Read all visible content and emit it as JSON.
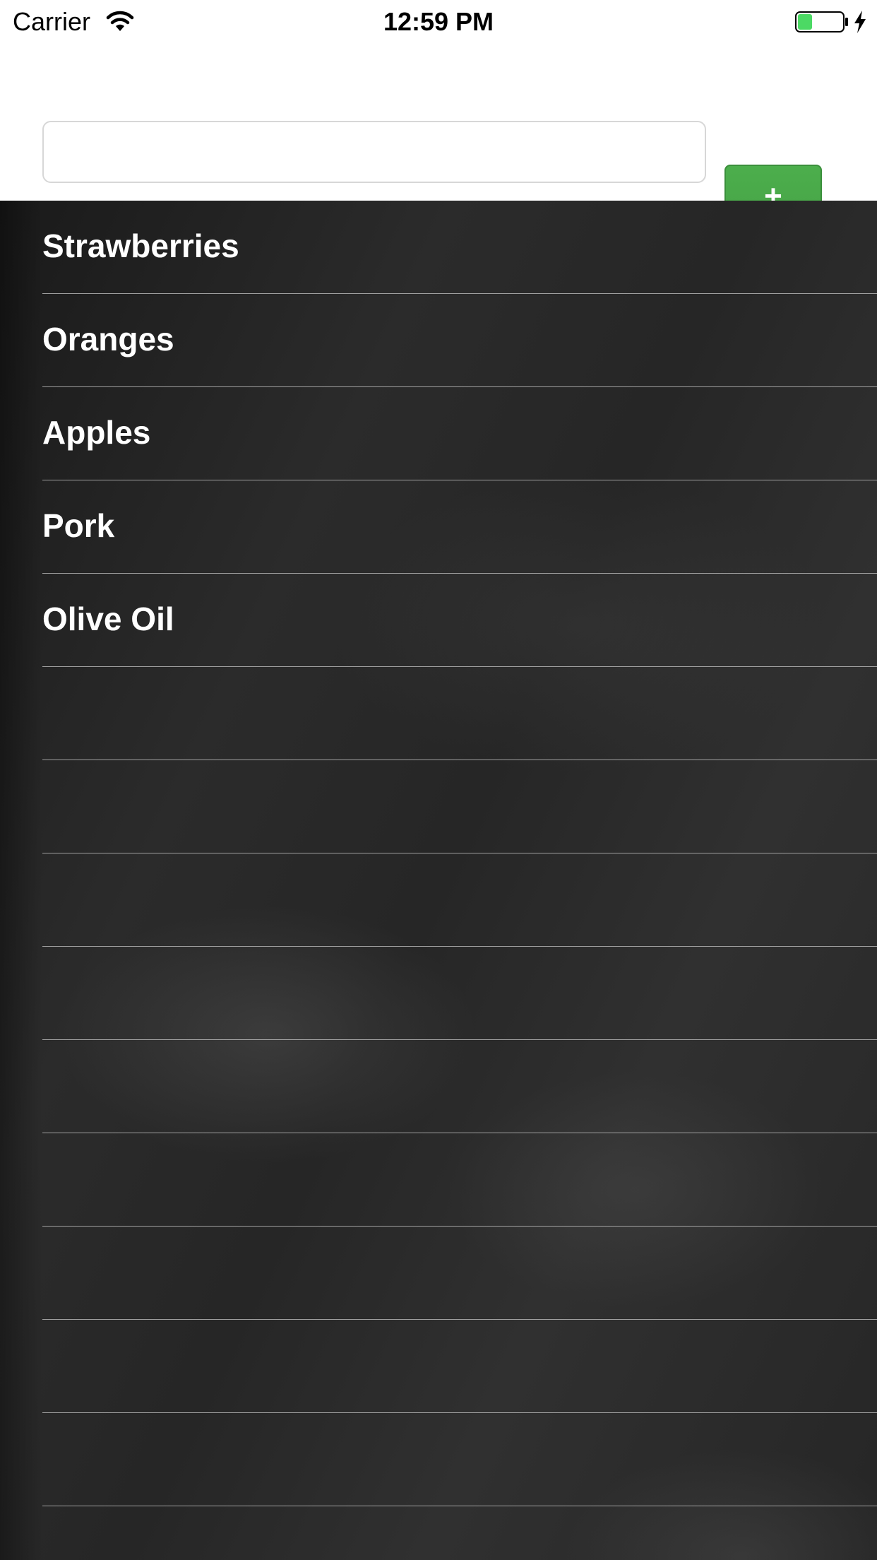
{
  "status_bar": {
    "carrier": "Carrier",
    "time": "12:59 PM",
    "battery_color": "#4cd964"
  },
  "entry": {
    "input_value": "",
    "input_placeholder": "",
    "add_label": "+",
    "add_color": "#4cae4c"
  },
  "list": {
    "items": [
      {
        "label": "Strawberries"
      },
      {
        "label": "Oranges"
      },
      {
        "label": "Apples"
      },
      {
        "label": "Pork"
      },
      {
        "label": "Olive Oil"
      },
      {
        "label": ""
      },
      {
        "label": ""
      },
      {
        "label": ""
      },
      {
        "label": ""
      },
      {
        "label": ""
      },
      {
        "label": ""
      },
      {
        "label": ""
      },
      {
        "label": ""
      },
      {
        "label": ""
      }
    ]
  }
}
